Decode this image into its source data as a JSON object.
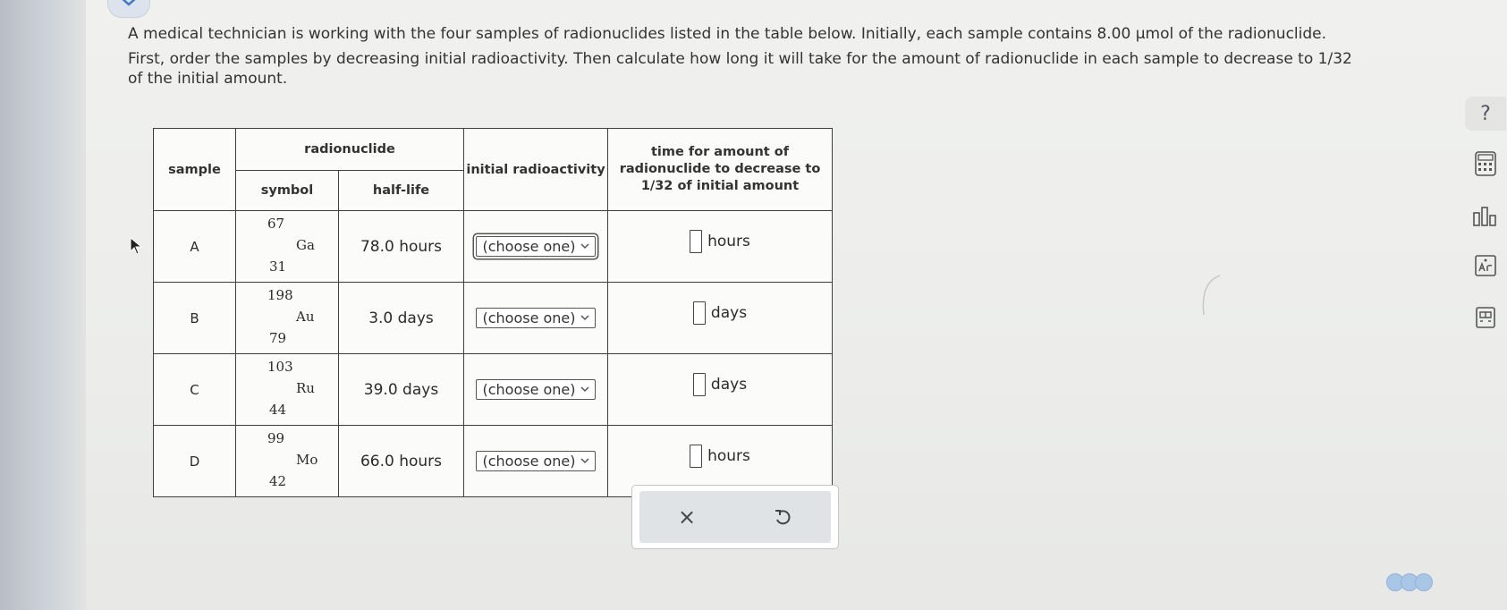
{
  "question": {
    "p1_text": "A medical technician is working with the four samples of radionuclides listed in the table below. Initially, each sample contains 8.00 μmol of the radionuclide.",
    "p2_line1": "First, order the samples by decreasing initial radioactivity. Then calculate how long it will take for the amount of radionuclide in each sample to decrease to 1/32",
    "p2_line2": "of the initial amount."
  },
  "table": {
    "headers": {
      "sample": "sample",
      "radionuclide": "radionuclide",
      "symbol": "symbol",
      "half_life": "half-life",
      "initial_radioactivity": "initial radioactivity",
      "time_line1": "time for amount of",
      "time_line2": "radionuclide to decrease to",
      "time_line3": "1/32 of initial amount"
    },
    "rows": [
      {
        "sample": "A",
        "mass": "67",
        "atomic": "31",
        "element": "Ga",
        "half_life": "78.0 hours",
        "select": "(choose one)",
        "unit": "hours"
      },
      {
        "sample": "B",
        "mass": "198",
        "atomic": "79",
        "element": "Au",
        "half_life": "3.0 days",
        "select": "(choose one)",
        "unit": "days"
      },
      {
        "sample": "C",
        "mass": "103",
        "atomic": "44",
        "element": "Ru",
        "half_life": "39.0 days",
        "select": "(choose one)",
        "unit": "days"
      },
      {
        "sample": "D",
        "mass": "99",
        "atomic": "42",
        "element": "Mo",
        "half_life": "66.0 hours",
        "select": "(choose one)",
        "unit": "hours"
      }
    ]
  },
  "actions": {
    "clear_symbol": "×"
  },
  "tools": {
    "help_symbol": "?"
  },
  "colors": {
    "accent": "#aac6e6",
    "panel": "#dfe3e6"
  },
  "icons": [
    "chevron-down-icon",
    "calculator-icon",
    "bar-chart-icon",
    "periodic-table-icon",
    "data-sheet-icon",
    "undo-icon"
  ]
}
